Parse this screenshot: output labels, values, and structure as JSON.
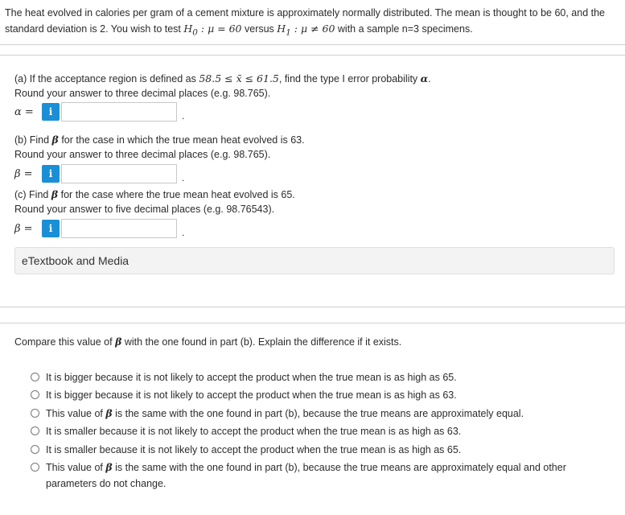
{
  "intro": {
    "text_a": "The heat evolved in calories per gram of a cement mixture is approximately normally distributed. The mean is thought to be 60, and the standard deviation is 2. You wish to test ",
    "h0": "H",
    "h0_sub": "0",
    "h0_rest": " : μ = 60",
    "versus": " versus ",
    "h1": "H",
    "h1_sub": "1",
    "h1_rest": " : μ ≠ 60",
    "text_b": " with a sample n=3 specimens."
  },
  "part_a": {
    "q_pre": "(a) If the acceptance region is defined as ",
    "region": "58.5 ≤ x̄ ≤ 61.5",
    "q_post": ", find the type I error probability ",
    "q_symbol": "α",
    "q_end": ".",
    "round": "Round your answer to three decimal places (e.g. 98.765).",
    "label": "α =",
    "value": ""
  },
  "part_b": {
    "q_pre": "(b) Find ",
    "q_symbol": "β",
    "q_post": " for the case in which the true mean heat evolved is 63.",
    "round": "Round your answer to three decimal places (e.g. 98.765).",
    "label": "β =",
    "value": ""
  },
  "part_c": {
    "q_pre": "(c) Find ",
    "q_symbol": "β",
    "q_post": " for the case where the true mean heat evolved is 65.",
    "round": "Round your answer to five decimal places (e.g. 98.76543).",
    "label": "β =",
    "value": ""
  },
  "info_glyph": "i",
  "period": ".",
  "etext_label": "eTextbook and Media",
  "compare": {
    "q_pre": "Compare this value of ",
    "q_symbol": "β",
    "q_post": " with the one found in part (b). Explain the difference if it exists.",
    "options": [
      {
        "text": "It is bigger because it is not likely to accept the product when the true mean is as high as 65."
      },
      {
        "text": "It is bigger because it is not likely to accept the product when the true mean is as high as 63."
      },
      {
        "pre": "This value of ",
        "symbol": "β",
        "post": " is the same with the one found in part (b), because the true means are approximately equal."
      },
      {
        "text": "It is smaller because it is not likely to accept the product when the true mean is as high as 63."
      },
      {
        "text": "It is smaller because it is not likely to accept the product when the true mean is as high as 65."
      },
      {
        "pre": "This value of ",
        "symbol": "β",
        "post": " is the same with the one found in part (b), because the true means are approximately equal and other parameters do not change."
      }
    ]
  },
  "colors": {
    "info_badge": "#1a8fd6",
    "divider": "#d0d0d0",
    "etext_bg": "#f3f3f3"
  }
}
